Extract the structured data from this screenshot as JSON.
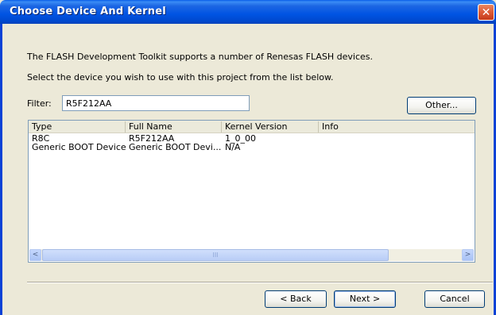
{
  "window": {
    "title": "Choose Device And Kernel",
    "close_glyph": "✕"
  },
  "intro": {
    "line1": "The FLASH Development Toolkit supports a number of Renesas FLASH devices.",
    "line2": "Select the device you wish to use with this project from the list below."
  },
  "filter": {
    "label": "Filter:",
    "value": "R5F212AA"
  },
  "buttons": {
    "other": "Other...",
    "back": "< Back",
    "next": "Next >",
    "cancel": "Cancel"
  },
  "list": {
    "columns": [
      "Type",
      "Full Name",
      "Kernel Version",
      "Info"
    ],
    "rows": [
      {
        "type": "R8C",
        "full_name": "R5F212AA",
        "kernel_version": "1_0_00",
        "info": ""
      },
      {
        "type": "Generic BOOT Device",
        "full_name": "Generic BOOT Devi...",
        "kernel_version": "N/A",
        "info": ""
      }
    ]
  },
  "scrollbar": {
    "left_arrow": "<",
    "right_arrow": ">",
    "thumb_grip": "III"
  },
  "colors": {
    "titlebar": "#0054e3",
    "close": "#dd5a36",
    "dialog_bg": "#ece9d8"
  }
}
